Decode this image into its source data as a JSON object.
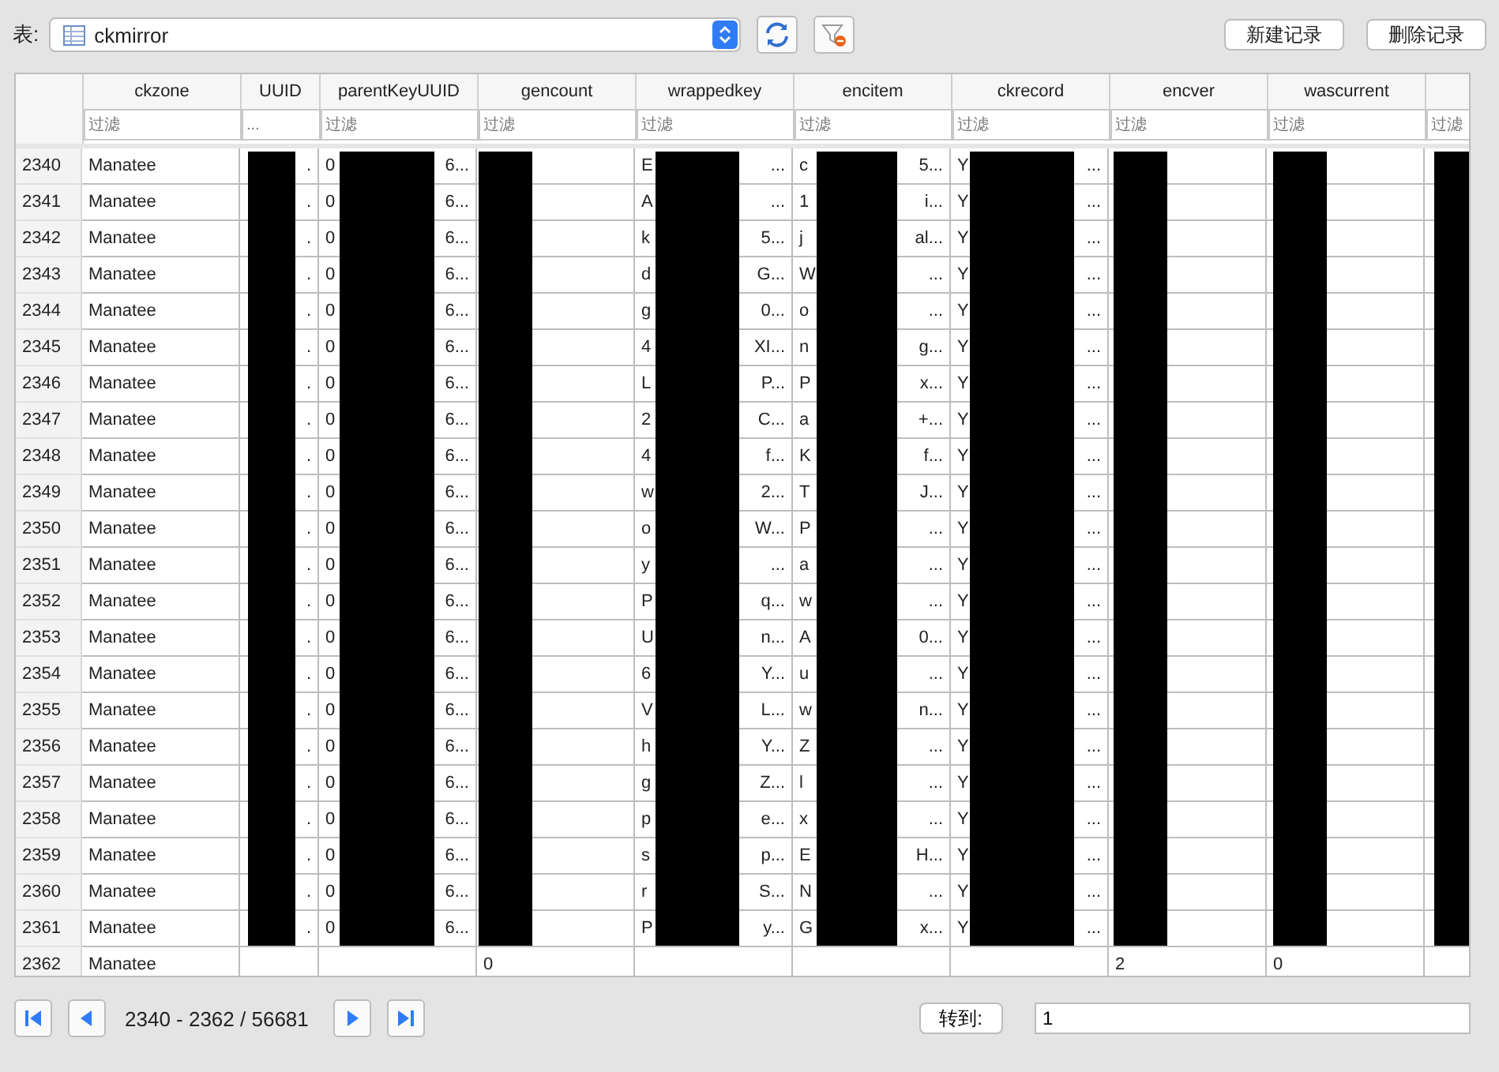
{
  "table_selector": {
    "label": "表:",
    "value": "ckmirror"
  },
  "buttons": [
    "新建记录",
    "删除记录"
  ],
  "table": {
    "columns": [
      {
        "name": "ckzone",
        "placeholder": "过滤",
        "redacted": false
      },
      {
        "name": "UUID",
        "placeholder": "...",
        "redacted": true
      },
      {
        "name": "parentKeyUUID",
        "placeholder": "过滤",
        "redacted": true
      },
      {
        "name": "gencount",
        "placeholder": "过滤",
        "redacted": true
      },
      {
        "name": "wrappedkey",
        "placeholder": "过滤",
        "redacted": true
      },
      {
        "name": "encitem",
        "placeholder": "过滤",
        "redacted": true
      },
      {
        "name": "ckrecord",
        "placeholder": "过滤",
        "redacted": true
      },
      {
        "name": "encver",
        "placeholder": "过滤",
        "redacted": true
      },
      {
        "name": "wascurrent",
        "placeholder": "过滤",
        "redacted": true
      },
      {
        "placeholder": "过滤",
        "redacted": true
      }
    ],
    "rows": [
      {
        "number": "2340",
        "cells": [
          {
            "head": "Manatee"
          },
          {
            "tail": "."
          },
          {
            "head": "0",
            "tail": "6..."
          },
          {},
          {
            "head": "E",
            "tail": "..."
          },
          {
            "head": "c",
            "tail": "5..."
          },
          {
            "head": "Y",
            "tail": "..."
          },
          {},
          {},
          {}
        ]
      },
      {
        "number": "2341",
        "cells": [
          {
            "head": "Manatee"
          },
          {
            "tail": "."
          },
          {
            "head": "0",
            "tail": "6..."
          },
          {},
          {
            "head": "A",
            "tail": "..."
          },
          {
            "head": "1",
            "tail": "i..."
          },
          {
            "head": "Y",
            "tail": "..."
          },
          {},
          {},
          {}
        ]
      },
      {
        "number": "2342",
        "cells": [
          {
            "head": "Manatee"
          },
          {
            "tail": "."
          },
          {
            "head": "0",
            "tail": "6..."
          },
          {},
          {
            "head": "k",
            "tail": "5..."
          },
          {
            "head": "j",
            "tail": "al..."
          },
          {
            "head": "Y",
            "tail": "..."
          },
          {},
          {},
          {}
        ]
      },
      {
        "number": "2343",
        "cells": [
          {
            "head": "Manatee"
          },
          {
            "tail": "."
          },
          {
            "head": "0",
            "tail": "6..."
          },
          {},
          {
            "head": "d",
            "tail": "G..."
          },
          {
            "head": "W",
            "tail": "..."
          },
          {
            "head": "Y",
            "tail": "..."
          },
          {},
          {},
          {}
        ]
      },
      {
        "number": "2344",
        "cells": [
          {
            "head": "Manatee"
          },
          {
            "tail": "."
          },
          {
            "head": "0",
            "tail": "6..."
          },
          {},
          {
            "head": "g",
            "tail": "0..."
          },
          {
            "head": "o",
            "tail": "..."
          },
          {
            "head": "Y",
            "tail": "..."
          },
          {},
          {},
          {}
        ]
      },
      {
        "number": "2345",
        "cells": [
          {
            "head": "Manatee"
          },
          {
            "tail": "."
          },
          {
            "head": "0",
            "tail": "6..."
          },
          {},
          {
            "head": "4",
            "tail": "XI..."
          },
          {
            "head": "n",
            "tail": "g..."
          },
          {
            "head": "Y",
            "tail": "..."
          },
          {},
          {},
          {}
        ]
      },
      {
        "number": "2346",
        "cells": [
          {
            "head": "Manatee"
          },
          {
            "tail": "."
          },
          {
            "head": "0",
            "tail": "6..."
          },
          {},
          {
            "head": "L",
            "tail": "P..."
          },
          {
            "head": "P",
            "tail": "x..."
          },
          {
            "head": "Y",
            "tail": "..."
          },
          {},
          {},
          {}
        ]
      },
      {
        "number": "2347",
        "cells": [
          {
            "head": "Manatee"
          },
          {
            "tail": "."
          },
          {
            "head": "0",
            "tail": "6..."
          },
          {},
          {
            "head": "2",
            "tail": "C..."
          },
          {
            "head": "a",
            "tail": "+..."
          },
          {
            "head": "Y",
            "tail": "..."
          },
          {},
          {},
          {}
        ]
      },
      {
        "number": "2348",
        "cells": [
          {
            "head": "Manatee"
          },
          {
            "tail": "."
          },
          {
            "head": "0",
            "tail": "6..."
          },
          {},
          {
            "head": "4",
            "tail": "f..."
          },
          {
            "head": "K",
            "tail": "f..."
          },
          {
            "head": "Y",
            "tail": "..."
          },
          {},
          {},
          {}
        ]
      },
      {
        "number": "2349",
        "cells": [
          {
            "head": "Manatee"
          },
          {
            "tail": "."
          },
          {
            "head": "0",
            "tail": "6..."
          },
          {},
          {
            "head": "w",
            "tail": "2..."
          },
          {
            "head": "T",
            "tail": "J..."
          },
          {
            "head": "Y",
            "tail": "..."
          },
          {},
          {},
          {}
        ]
      },
      {
        "number": "2350",
        "cells": [
          {
            "head": "Manatee"
          },
          {
            "tail": "."
          },
          {
            "head": "0",
            "tail": "6..."
          },
          {},
          {
            "head": "o",
            "tail": "W..."
          },
          {
            "head": "P",
            "tail": "..."
          },
          {
            "head": "Y",
            "tail": "..."
          },
          {},
          {},
          {}
        ]
      },
      {
        "number": "2351",
        "cells": [
          {
            "head": "Manatee"
          },
          {
            "tail": "."
          },
          {
            "head": "0",
            "tail": "6..."
          },
          {},
          {
            "head": "y",
            "tail": "..."
          },
          {
            "head": "a",
            "tail": "..."
          },
          {
            "head": "Y",
            "tail": "..."
          },
          {},
          {},
          {}
        ]
      },
      {
        "number": "2352",
        "cells": [
          {
            "head": "Manatee"
          },
          {
            "tail": "."
          },
          {
            "head": "0",
            "tail": "6..."
          },
          {},
          {
            "head": "P",
            "tail": "q..."
          },
          {
            "head": "w",
            "tail": "..."
          },
          {
            "head": "Y",
            "tail": "..."
          },
          {},
          {},
          {}
        ]
      },
      {
        "number": "2353",
        "cells": [
          {
            "head": "Manatee"
          },
          {
            "tail": "."
          },
          {
            "head": "0",
            "tail": "6..."
          },
          {},
          {
            "head": "U",
            "tail": "n..."
          },
          {
            "head": "A",
            "tail": "0..."
          },
          {
            "head": "Y",
            "tail": "..."
          },
          {},
          {},
          {}
        ]
      },
      {
        "number": "2354",
        "cells": [
          {
            "head": "Manatee"
          },
          {
            "tail": "."
          },
          {
            "head": "0",
            "tail": "6..."
          },
          {},
          {
            "head": "6",
            "tail": "Y..."
          },
          {
            "head": "u",
            "tail": "..."
          },
          {
            "head": "Y",
            "tail": "..."
          },
          {},
          {},
          {}
        ]
      },
      {
        "number": "2355",
        "cells": [
          {
            "head": "Manatee"
          },
          {
            "tail": "."
          },
          {
            "head": "0",
            "tail": "6..."
          },
          {},
          {
            "head": "V",
            "tail": "L..."
          },
          {
            "head": "w",
            "tail": "n..."
          },
          {
            "head": "Y",
            "tail": "..."
          },
          {},
          {},
          {}
        ]
      },
      {
        "number": "2356",
        "cells": [
          {
            "head": "Manatee"
          },
          {
            "tail": "."
          },
          {
            "head": "0",
            "tail": "6..."
          },
          {},
          {
            "head": "h",
            "tail": "Y..."
          },
          {
            "head": "Z",
            "tail": "..."
          },
          {
            "head": "Y",
            "tail": "..."
          },
          {},
          {},
          {}
        ]
      },
      {
        "number": "2357",
        "cells": [
          {
            "head": "Manatee"
          },
          {
            "tail": "."
          },
          {
            "head": "0",
            "tail": "6..."
          },
          {},
          {
            "head": "g",
            "tail": "Z..."
          },
          {
            "head": "l",
            "tail": "..."
          },
          {
            "head": "Y",
            "tail": "..."
          },
          {},
          {},
          {}
        ]
      },
      {
        "number": "2358",
        "cells": [
          {
            "head": "Manatee"
          },
          {
            "tail": "."
          },
          {
            "head": "0",
            "tail": "6..."
          },
          {},
          {
            "head": "p",
            "tail": "e..."
          },
          {
            "head": "x",
            "tail": "..."
          },
          {
            "head": "Y",
            "tail": "..."
          },
          {},
          {},
          {}
        ]
      },
      {
        "number": "2359",
        "cells": [
          {
            "head": "Manatee"
          },
          {
            "tail": "."
          },
          {
            "head": "0",
            "tail": "6..."
          },
          {},
          {
            "head": "s",
            "tail": "p..."
          },
          {
            "head": "E",
            "tail": "H..."
          },
          {
            "head": "Y",
            "tail": "..."
          },
          {},
          {},
          {}
        ]
      },
      {
        "number": "2360",
        "cells": [
          {
            "head": "Manatee"
          },
          {
            "tail": "."
          },
          {
            "head": "0",
            "tail": "6..."
          },
          {},
          {
            "head": "r",
            "tail": "S..."
          },
          {
            "head": "N",
            "tail": "..."
          },
          {
            "head": "Y",
            "tail": "..."
          },
          {},
          {},
          {}
        ]
      },
      {
        "number": "2361",
        "cells": [
          {
            "head": "Manatee"
          },
          {
            "tail": "."
          },
          {
            "head": "0",
            "tail": "6..."
          },
          {},
          {
            "head": "P",
            "tail": "y..."
          },
          {
            "head": "G",
            "tail": "x..."
          },
          {
            "head": "Y",
            "tail": "..."
          },
          {},
          {},
          {}
        ]
      },
      {
        "number": "2362",
        "cells": [
          {
            "head": "Manatee"
          },
          {},
          {},
          {
            "head": "0"
          },
          {},
          {},
          {},
          {
            "head": "2"
          },
          {
            "head": "0"
          },
          {}
        ]
      }
    ]
  },
  "pager": {
    "range": "2340 - 2362 / 56681",
    "goto_label": "转到:",
    "goto_value": "1"
  }
}
